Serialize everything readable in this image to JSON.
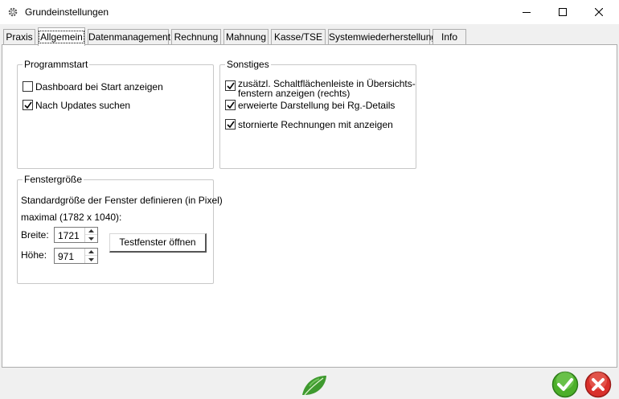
{
  "window": {
    "title": "Grundeinstellungen",
    "title_icon": "gear-icon"
  },
  "tabs": [
    {
      "label": "Praxis",
      "active": false
    },
    {
      "label": "Allgemein",
      "active": true
    },
    {
      "label": "Datenmanagement",
      "active": false
    },
    {
      "label": "Rechnung",
      "active": false
    },
    {
      "label": "Mahnung",
      "active": false
    },
    {
      "label": "Kasse/TSE",
      "active": false
    },
    {
      "label": "Systemwiederherstellung",
      "active": false
    },
    {
      "label": "Info",
      "active": false
    }
  ],
  "programmstart": {
    "title": "Programmstart",
    "options": [
      {
        "label": "Dashboard bei Start anzeigen",
        "checked": false
      },
      {
        "label": "Nach Updates suchen",
        "checked": true
      }
    ]
  },
  "sonstiges": {
    "title": "Sonstiges",
    "options": [
      {
        "label_line1": "zusätzl. Schaltflächenleiste in Übersichts-",
        "label_line2": "fenstern anzeigen (rechts)",
        "checked": true
      },
      {
        "label": "erweierte Darstellung bei Rg.-Details",
        "checked": true
      },
      {
        "label": "stornierte Rechnungen mit anzeigen",
        "checked": true
      }
    ]
  },
  "fenstergroesse": {
    "title": "Fenstergröße",
    "description": "Standardgröße der Fenster definieren (in Pixel)",
    "max_info": "maximal (1782 x 1040):",
    "width_label": "Breite:",
    "width_value": "1721",
    "height_label": "Höhe:",
    "height_value": "971",
    "test_button": "Testfenster öffnen"
  },
  "footer": {
    "center_icon": "leaf-icon",
    "ok_icon": "ok-check-icon",
    "cancel_icon": "cancel-x-icon"
  },
  "colors": {
    "ok_green": "#4caf2a",
    "cancel_red": "#d9302b",
    "leaf_green": "#3f9a2f"
  }
}
